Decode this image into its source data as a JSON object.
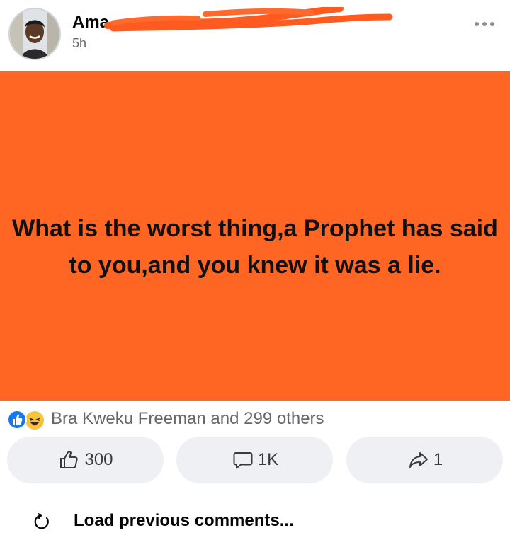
{
  "post": {
    "author_name": "Ama",
    "timestamp": "5h",
    "text": "What is the worst thing,a Prophet has said to you,and you knew it was a lie.",
    "background_color": "#ff6624"
  },
  "reactions": {
    "icons": [
      "like-icon",
      "haha-icon"
    ],
    "summary": "Bra Kweku Freeman and 299 others"
  },
  "actions": {
    "like_count": "300",
    "comment_count": "1K",
    "share_count": "1"
  },
  "comments": {
    "load_previous_label": "Load previous comments..."
  },
  "colors": {
    "redaction": "#ff5a1f",
    "like_blue": "#1877f2",
    "haha_yellow": "#f7c33b",
    "button_bg": "#eef0f3"
  }
}
